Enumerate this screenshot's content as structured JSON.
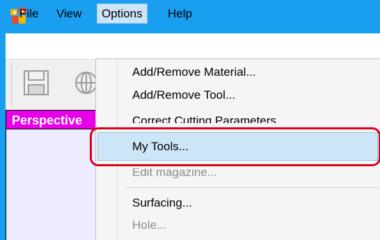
{
  "window": {
    "app_icon": "robot-app-icon",
    "accent_color": "#1a9ef0"
  },
  "menubar": {
    "items": [
      {
        "label": "File"
      },
      {
        "label": "View"
      },
      {
        "label": "Options"
      },
      {
        "label": "Help"
      }
    ],
    "open_item": "Options"
  },
  "toolbar": {
    "icons": [
      "save-icon",
      "globe-icon"
    ]
  },
  "panel": {
    "title": "Perspective",
    "header_color": "#e800e8"
  },
  "options_menu": {
    "items": [
      {
        "label": "Add/Remove Material...",
        "enabled": true
      },
      {
        "label": "Add/Remove Tool...",
        "enabled": true
      },
      {
        "label": "Correct Cutting Parameters...",
        "enabled": true
      },
      {
        "label": "My Tools...",
        "enabled": true,
        "highlighted": true
      },
      {
        "label": "Edit magazine...",
        "enabled": false
      },
      {
        "label": "Surfacing...",
        "enabled": true
      },
      {
        "label": "Hole...",
        "enabled": false
      }
    ]
  },
  "annotation": {
    "callout_color": "#d9001e",
    "target": "My Tools..."
  }
}
